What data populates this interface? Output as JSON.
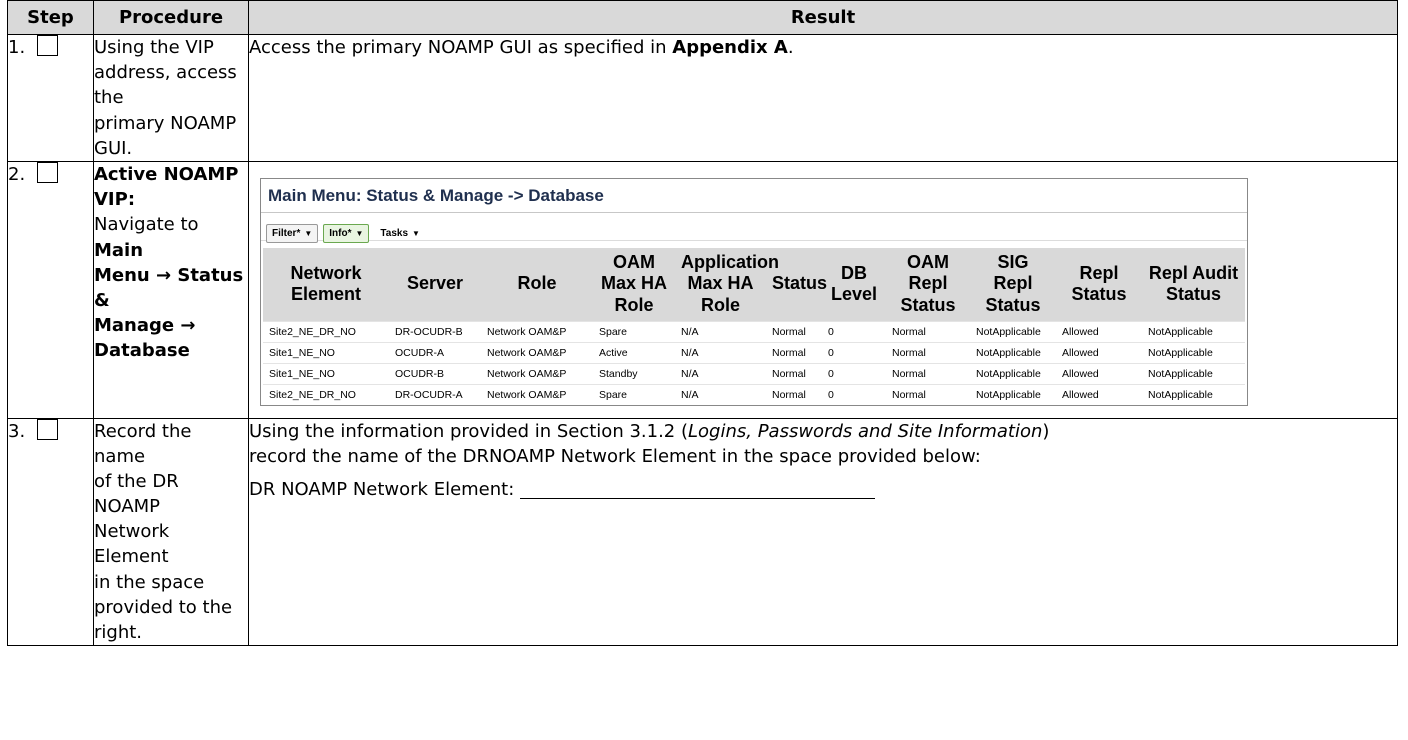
{
  "headers": {
    "step": "Step",
    "procedure": "Procedure",
    "result": "Result"
  },
  "steps": [
    {
      "number": "1.",
      "procedure_lines": [
        "Using the VIP",
        "address, access the",
        "primary NOAMP",
        "GUI."
      ],
      "result_text": "Access the primary NOAMP GUI as specified in ",
      "result_bold": "Appendix A",
      "result_tail": "."
    },
    {
      "number": "2.",
      "procedure": {
        "title_line1": "Active NOAMP",
        "title_line2": "VIP:",
        "nav_prefix": "Navigate to ",
        "nav_line1_bold": "Main",
        "nav_line2_bold": "Menu → Status &",
        "nav_line3_bold": "Manage →",
        "nav_line4_bold": "Database"
      },
      "screenshot": {
        "title": "Main Menu: Status & Manage -> Database",
        "buttons": [
          "Filter*",
          "Info*",
          "Tasks"
        ],
        "columns": [
          "Network Element",
          "Server",
          "Role",
          "OAM Max HA Role",
          "Application Max HA Role",
          "Status",
          "DB Level",
          "OAM Repl Status",
          "SIG Repl Status",
          "Repl Status",
          "Repl Audit Status"
        ],
        "rows": [
          [
            "Site2_NE_DR_NO",
            "DR-OCUDR-B",
            "Network OAM&P",
            "Spare",
            "N/A",
            "Normal",
            "0",
            "Normal",
            "NotApplicable",
            "Allowed",
            "NotApplicable"
          ],
          [
            "Site1_NE_NO",
            "OCUDR-A",
            "Network OAM&P",
            "Active",
            "N/A",
            "Normal",
            "0",
            "Normal",
            "NotApplicable",
            "Allowed",
            "NotApplicable"
          ],
          [
            "Site1_NE_NO",
            "OCUDR-B",
            "Network OAM&P",
            "Standby",
            "N/A",
            "Normal",
            "0",
            "Normal",
            "NotApplicable",
            "Allowed",
            "NotApplicable"
          ],
          [
            "Site2_NE_DR_NO",
            "DR-OCUDR-A",
            "Network OAM&P",
            "Spare",
            "N/A",
            "Normal",
            "0",
            "Normal",
            "NotApplicable",
            "Allowed",
            "NotApplicable"
          ]
        ]
      }
    },
    {
      "number": "3.",
      "procedure_lines": [
        "Record the name",
        "of the DR NOAMP",
        "Network Element",
        "in the space",
        "provided to the",
        "right."
      ],
      "result_line1_prefix": "Using the information provided in Section 3.1.2 (",
      "result_line1_italic": "Logins, Passwords and Site Information",
      "result_line1_suffix": ")",
      "result_line2": "record the name of the DRNOAMP Network Element in the space provided below:",
      "field_label": "DR NOAMP Network Element: "
    }
  ],
  "colors": {
    "header_bg": "#d9d9d9",
    "table_header_bg": "#e6e9ee",
    "title_color": "#1f2f4e",
    "info_button_border": "#6aa84f"
  },
  "icons": {
    "checkbox": "empty-checkbox",
    "caret": "caret-down-icon",
    "arrow": "right-arrow"
  }
}
